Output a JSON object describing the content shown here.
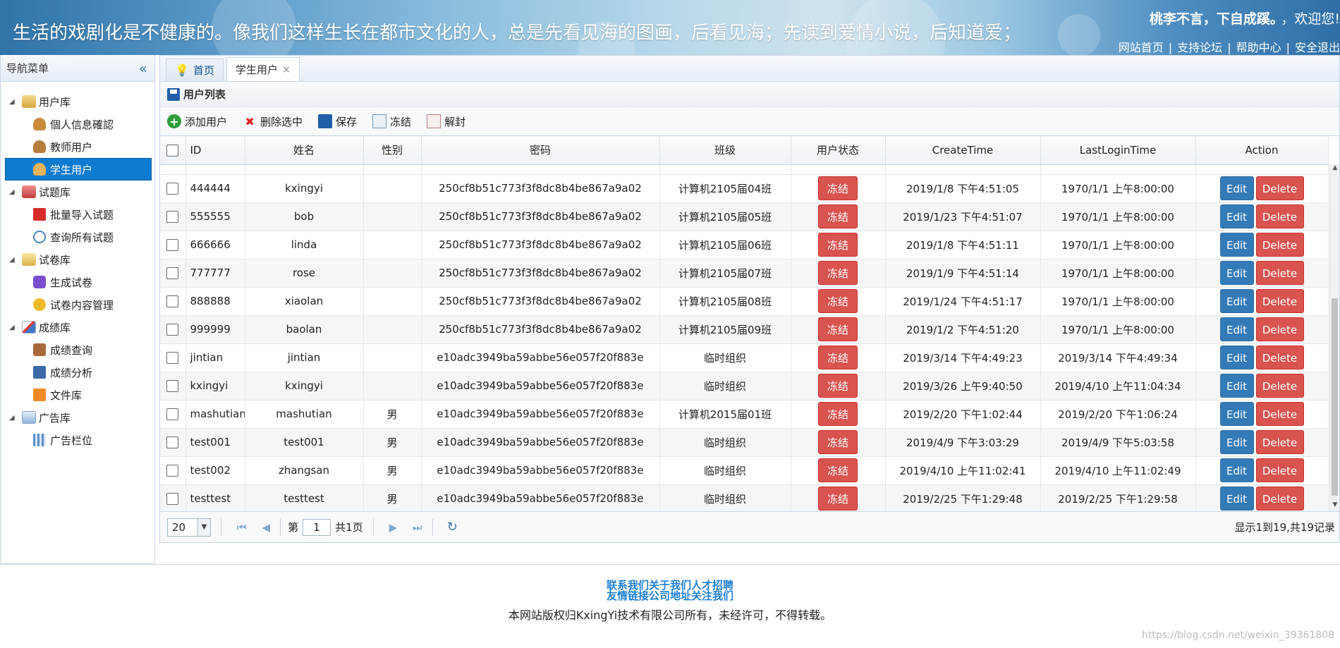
{
  "banner": {
    "slogan": "生活的戏剧化是不健康的。像我们这样生长在都市文化的人，总是先看见海的图画，后看见海；先读到爱情小说，后知道爱；",
    "motto": "桃李不言，下自成蹊。",
    "welcome": "，欢迎您!",
    "links": [
      "网站首页",
      "支持论坛",
      "帮助中心",
      "安全退出"
    ]
  },
  "sidebar": {
    "title": "导航菜单",
    "groups": [
      {
        "label": "用户库",
        "items": [
          "個人信息確認",
          "教师用户",
          "学生用户"
        ]
      },
      {
        "label": "试题库",
        "items": [
          "批量导入试题",
          "查询所有试题"
        ]
      },
      {
        "label": "试卷库",
        "items": [
          "生成试卷",
          "试卷内容管理"
        ]
      },
      {
        "label": "成绩库",
        "items": [
          "成绩查询",
          "成绩分析",
          "文件库"
        ]
      },
      {
        "label": "广告库",
        "items": [
          "广告栏位"
        ]
      }
    ]
  },
  "tabs": [
    {
      "label": "首页"
    },
    {
      "label": "学生用户",
      "close": "×"
    }
  ],
  "panel": {
    "title": "用户列表"
  },
  "toolbar": {
    "add": "添加用户",
    "delete_selected": "删除选中",
    "save": "保存",
    "freeze": "冻结",
    "unseal": "解封"
  },
  "table": {
    "headers": [
      "ID",
      "姓名",
      "性别",
      "密码",
      "班级",
      "用户状态",
      "CreateTime",
      "LastLoginTime",
      "Action"
    ],
    "status_button": "冻结",
    "edit_button": "Edit",
    "delete_button": "Delete",
    "rows": [
      {
        "id": "444444",
        "name": "kxingyi",
        "gender": "",
        "password": "250cf8b51c773f3f8dc8b4be867a9a02",
        "class": "计算机2105届04班",
        "create": "2019/1/8 下午4:51:05",
        "login": "1970/1/1 上午8:00:00"
      },
      {
        "id": "555555",
        "name": "bob",
        "gender": "",
        "password": "250cf8b51c773f3f8dc8b4be867a9a02",
        "class": "计算机2105届05班",
        "create": "2019/1/23 下午4:51:07",
        "login": "1970/1/1 上午8:00:00"
      },
      {
        "id": "666666",
        "name": "linda",
        "gender": "",
        "password": "250cf8b51c773f3f8dc8b4be867a9a02",
        "class": "计算机2105届06班",
        "create": "2019/1/8 下午4:51:11",
        "login": "1970/1/1 上午8:00:00"
      },
      {
        "id": "777777",
        "name": "rose",
        "gender": "",
        "password": "250cf8b51c773f3f8dc8b4be867a9a02",
        "class": "计算机2105届07班",
        "create": "2019/1/9 下午4:51:14",
        "login": "1970/1/1 上午8:00:00"
      },
      {
        "id": "888888",
        "name": "xiaolan",
        "gender": "",
        "password": "250cf8b51c773f3f8dc8b4be867a9a02",
        "class": "计算机2105届08班",
        "create": "2019/1/24 下午4:51:17",
        "login": "1970/1/1 上午8:00:00"
      },
      {
        "id": "999999",
        "name": "baolan",
        "gender": "",
        "password": "250cf8b51c773f3f8dc8b4be867a9a02",
        "class": "计算机2105届09班",
        "create": "2019/1/2 下午4:51:20",
        "login": "1970/1/1 上午8:00:00"
      },
      {
        "id": "jintian",
        "name": "jintian",
        "gender": "",
        "password": "e10adc3949ba59abbe56e057f20f883e",
        "class": "临时组织",
        "create": "2019/3/14 下午4:49:23",
        "login": "2019/3/14 下午4:49:34"
      },
      {
        "id": "kxingyi",
        "name": "kxingyi",
        "gender": "",
        "password": "e10adc3949ba59abbe56e057f20f883e",
        "class": "临时组织",
        "create": "2019/3/26 上午9:40:50",
        "login": "2019/4/10 上午11:04:34"
      },
      {
        "id": "mashutian",
        "name": "mashutian",
        "gender": "男",
        "password": "e10adc3949ba59abbe56e057f20f883e",
        "class": "计算机2015届01班",
        "create": "2019/2/20 下午1:02:44",
        "login": "2019/2/20 下午1:06:24"
      },
      {
        "id": "test001",
        "name": "test001",
        "gender": "男",
        "password": "e10adc3949ba59abbe56e057f20f883e",
        "class": "临时组织",
        "create": "2019/4/9 下午3:03:29",
        "login": "2019/4/9 下午5:03:58"
      },
      {
        "id": "test002",
        "name": "zhangsan",
        "gender": "男",
        "password": "e10adc3949ba59abbe56e057f20f883e",
        "class": "临时组织",
        "create": "2019/4/10 上午11:02:41",
        "login": "2019/4/10 上午11:02:49"
      },
      {
        "id": "testtest",
        "name": "testtest",
        "gender": "男",
        "password": "e10adc3949ba59abbe56e057f20f883e",
        "class": "临时组织",
        "create": "2019/2/25 下午1:29:48",
        "login": "2019/2/25 下午1:29:58"
      }
    ]
  },
  "pager": {
    "page_size": "20",
    "page_label": "第",
    "page_value": "1",
    "total_pages": "共1页",
    "info": "显示1到19,共19记录"
  },
  "footer": {
    "links_row1": "联系我们关于我们人才招聘",
    "links_row2": "友情链接公司地址关注我们",
    "copyright": "本网站版权归KxingYi技术有限公司所有，未经许可，不得转载。",
    "watermark": "https://blog.csdn.net/weixin_39361808"
  }
}
